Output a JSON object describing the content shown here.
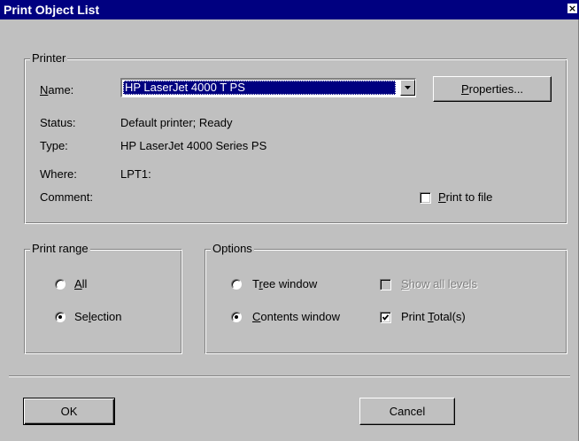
{
  "window": {
    "title": "Print Object List",
    "close_glyph": "×"
  },
  "printer_group": {
    "legend": "Printer",
    "name_label": "Name:",
    "name_value": "HP LaserJet 4000 T PS",
    "properties_label": "Properties...",
    "status_label": "Status:",
    "status_value": "Default printer; Ready",
    "type_label": "Type:",
    "type_value": "HP LaserJet 4000 Series PS",
    "where_label": "Where:",
    "where_value": "LPT1:",
    "comment_label": "Comment:",
    "print_to_file_label": "Print to file",
    "print_to_file_checked": false
  },
  "print_range_group": {
    "legend": "Print range",
    "all_label": "All",
    "selection_label": "Selection",
    "selected": "Selection"
  },
  "options_group": {
    "legend": "Options",
    "tree_window_label": "Tree window",
    "contents_window_label": "Contents window",
    "selected": "Contents window",
    "show_all_levels_label": "Show all levels",
    "show_all_levels_enabled": false,
    "show_all_levels_checked": false,
    "print_totals_label": "Print Total(s)",
    "print_totals_checked": true
  },
  "footer": {
    "ok_label": "OK",
    "cancel_label": "Cancel"
  },
  "colors": {
    "title_bar": "#000080",
    "face": "#c0c0c0",
    "highlight": "#000080"
  }
}
